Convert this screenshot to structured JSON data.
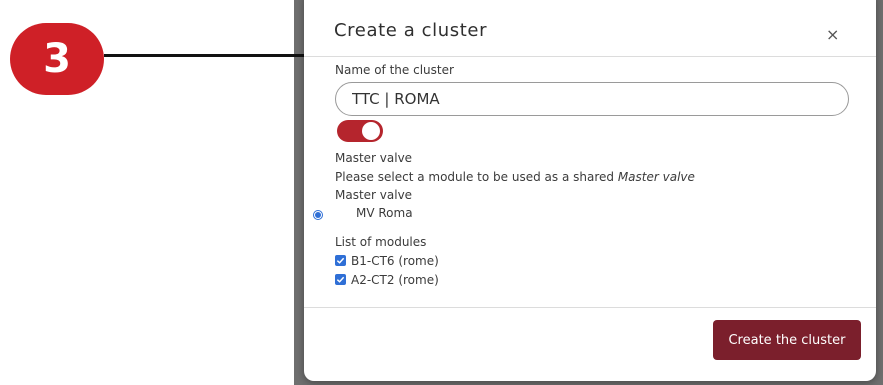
{
  "annotation": {
    "step_number": "3"
  },
  "modal": {
    "title": "Create a cluster",
    "close_label": "×",
    "name_label": "Name of the cluster",
    "name_value": "TTC | ROMA",
    "toggle_on": true,
    "master_valve_heading": "Master valve",
    "instruction_prefix": "Please select a module to be used as a shared ",
    "instruction_emphasis": "Master valve",
    "master_valve_label": "Master valve",
    "master_valve_option": "MV Roma",
    "modules_label": "List of modules",
    "modules": [
      {
        "label": "B1-CT6 (rome)",
        "checked": true
      },
      {
        "label": "A2-CT2 (rome)",
        "checked": true
      }
    ],
    "submit_label": "Create the cluster"
  },
  "colors": {
    "badge": "#cf2027",
    "toggle": "#b5252d",
    "button": "#7b1f2c",
    "checkbox": "#2f6fd6",
    "backdrop": "#6f6f6f"
  }
}
